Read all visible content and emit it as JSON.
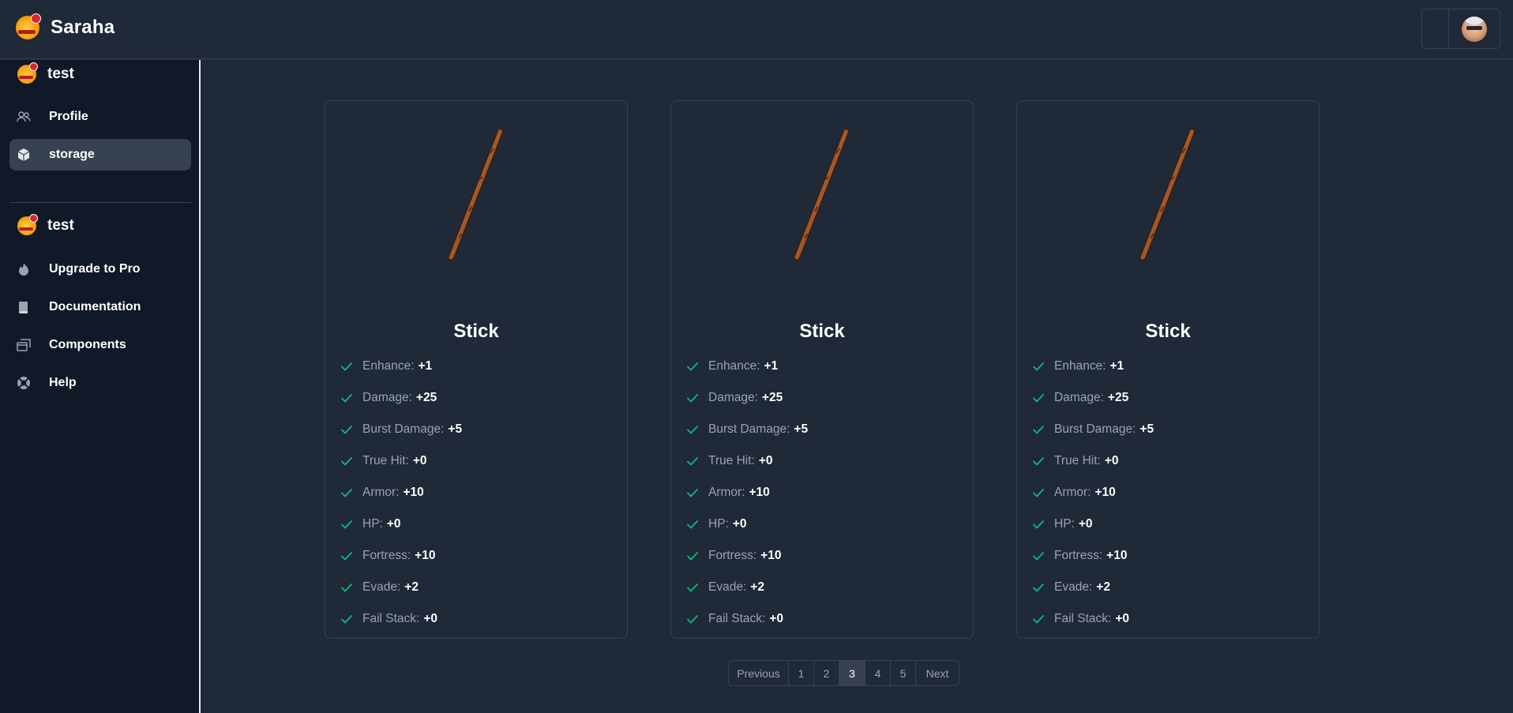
{
  "header": {
    "brand": "Saraha",
    "avatar_icon": "user-avatar"
  },
  "sidebar": {
    "section1": {
      "title": "test",
      "items": [
        {
          "label": "Profile",
          "icon": "users-icon"
        },
        {
          "label": "storage",
          "icon": "cube-icon",
          "active": true
        }
      ]
    },
    "section2": {
      "title": "test",
      "items": [
        {
          "label": "Upgrade to Pro",
          "icon": "fire-icon"
        },
        {
          "label": "Documentation",
          "icon": "book-icon"
        },
        {
          "label": "Components",
          "icon": "windows-icon"
        },
        {
          "label": "Help",
          "icon": "lifebuoy-icon"
        }
      ]
    }
  },
  "cards": [
    {
      "name": "Stick",
      "stats": [
        {
          "label": "Enhance:",
          "value": "+1"
        },
        {
          "label": "Damage:",
          "value": "+25"
        },
        {
          "label": "Burst Damage:",
          "value": "+5"
        },
        {
          "label": "True Hit:",
          "value": "+0"
        },
        {
          "label": "Armor:",
          "value": "+10"
        },
        {
          "label": "HP:",
          "value": "+0"
        },
        {
          "label": "Fortress:",
          "value": "+10"
        },
        {
          "label": "Evade:",
          "value": "+2"
        },
        {
          "label": "Fail Stack:",
          "value": "+0"
        }
      ]
    },
    {
      "name": "Stick",
      "stats": [
        {
          "label": "Enhance:",
          "value": "+1"
        },
        {
          "label": "Damage:",
          "value": "+25"
        },
        {
          "label": "Burst Damage:",
          "value": "+5"
        },
        {
          "label": "True Hit:",
          "value": "+0"
        },
        {
          "label": "Armor:",
          "value": "+10"
        },
        {
          "label": "HP:",
          "value": "+0"
        },
        {
          "label": "Fortress:",
          "value": "+10"
        },
        {
          "label": "Evade:",
          "value": "+2"
        },
        {
          "label": "Fail Stack:",
          "value": "+0"
        }
      ]
    },
    {
      "name": "Stick",
      "stats": [
        {
          "label": "Enhance:",
          "value": "+1"
        },
        {
          "label": "Damage:",
          "value": "+25"
        },
        {
          "label": "Burst Damage:",
          "value": "+5"
        },
        {
          "label": "True Hit:",
          "value": "+0"
        },
        {
          "label": "Armor:",
          "value": "+10"
        },
        {
          "label": "HP:",
          "value": "+0"
        },
        {
          "label": "Fortress:",
          "value": "+10"
        },
        {
          "label": "Evade:",
          "value": "+2"
        },
        {
          "label": "Fail Stack:",
          "value": "+0"
        }
      ]
    }
  ],
  "pagination": {
    "previous": "Previous",
    "pages": [
      "1",
      "2",
      "3",
      "4",
      "5"
    ],
    "current": "3",
    "next": "Next"
  },
  "colors": {
    "check": "#10b981",
    "bg": "#1f2937",
    "sidebar_bg": "#111827",
    "border": "#374151"
  }
}
